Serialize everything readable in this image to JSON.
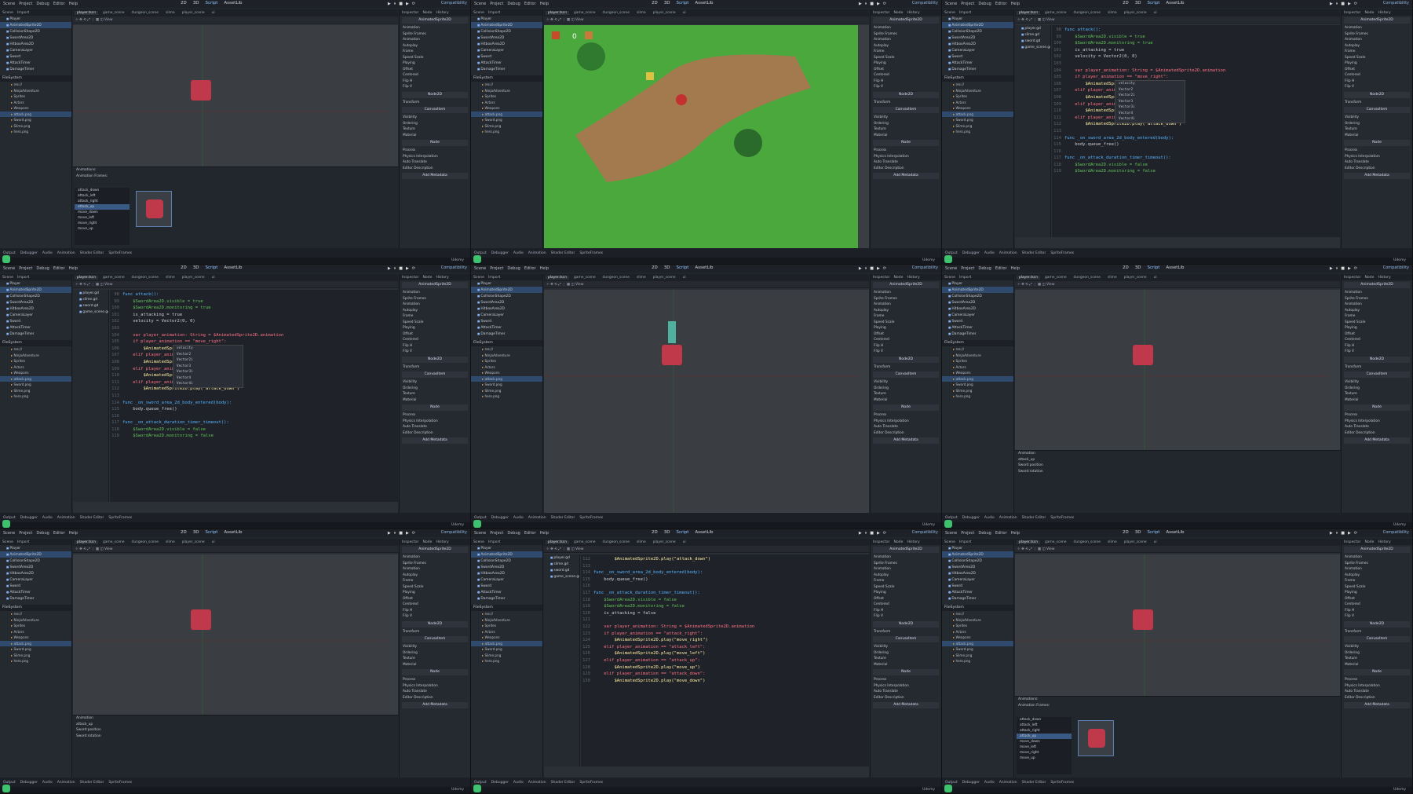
{
  "menu": [
    "Scene",
    "Project",
    "Debug",
    "Editor",
    "Help"
  ],
  "modes": [
    "2D",
    "3D",
    "Script",
    "AssetLib"
  ],
  "renderer": "Compatibility",
  "statusbar_text": "Udemy",
  "version": "4.3.stable",
  "scene_tabs": [
    "player.tscn",
    "game_scene",
    "dungeon_scene",
    "slime",
    "player_scene",
    "ui"
  ],
  "scene_tree": [
    "Player",
    "AnimatedSprite2D",
    "CollisionShape2D",
    "SwordArea2D",
    "HitboxArea2D",
    "CameraLayer",
    "Sword",
    "AttackTimer",
    "DamageTimer"
  ],
  "filesystem_title": "FileSystem",
  "filesystem": [
    "res://",
    "NinjaAdventure",
    "Sprites",
    "Actors",
    "Weapons",
    "attack.png",
    "Sword.png",
    "Slime.png",
    "hero.png"
  ],
  "bottom_tabs": [
    "Output",
    "Debugger",
    "Audio",
    "Animation",
    "Shader Editor",
    "SpriteFrames"
  ],
  "inspector": {
    "node": "AnimatedSprite2D",
    "rows": [
      "Animation",
      "Sprite Frames",
      "Animation",
      "Autoplay",
      "Frame",
      "Speed Scale",
      "Playing",
      "Offset",
      "Centered",
      "Flip H",
      "Flip V"
    ],
    "sections": [
      "Node2D",
      "CanvasItem",
      "Node"
    ],
    "subrows": [
      "Transform",
      "Visibility",
      "Ordering",
      "Texture",
      "Material",
      "Process",
      "Physics Interpolation",
      "Auto Translate",
      "Editor Description"
    ],
    "add_button": "Add Metadata"
  },
  "animations": [
    "attack_down",
    "attack_left",
    "attack_right",
    "attack_up",
    "move_down",
    "move_left",
    "move_right",
    "move_up"
  ],
  "anim_header": "Animations:",
  "frames_header": "Animation Frames:",
  "game_score": "0",
  "code_a": [
    {
      "n": "98",
      "t": "func attack():",
      "c": "fn"
    },
    {
      "n": "99",
      "t": "    $SwordArea2D.visible = true",
      "c": "node"
    },
    {
      "n": "100",
      "t": "    $SwordArea2D.monitoring = true",
      "c": "node"
    },
    {
      "n": "101",
      "t": "    is_attacking = true",
      "c": "var"
    },
    {
      "n": "102",
      "t": "    velocity = Vector2(0, 0)",
      "c": "var"
    },
    {
      "n": "103",
      "t": "",
      "c": "var"
    },
    {
      "n": "104",
      "t": "    var player_animation: String = $AnimatedSprite2D.animation",
      "c": "kw"
    },
    {
      "n": "105",
      "t": "    if player_animation == \"move_right\":",
      "c": "kw"
    },
    {
      "n": "106",
      "t": "        $AnimatedSprite2D.play(\"attack_right\")",
      "c": "str"
    },
    {
      "n": "107",
      "t": "    elif player_animation == \"move_left\":",
      "c": "kw"
    },
    {
      "n": "108",
      "t": "        $AnimatedSprite2D.play(\"attack_left\")",
      "c": "str"
    },
    {
      "n": "109",
      "t": "    elif player_animation == \"move_up\":",
      "c": "kw"
    },
    {
      "n": "110",
      "t": "        $AnimatedSprite2D.play(\"attack_up\")",
      "c": "str"
    },
    {
      "n": "111",
      "t": "    elif player_animation == \"move_down\":",
      "c": "kw"
    },
    {
      "n": "112",
      "t": "        $AnimatedSprite2D.play(\"attack_down\")",
      "c": "str"
    },
    {
      "n": "113",
      "t": "",
      "c": "var"
    },
    {
      "n": "114",
      "t": "func _on_sword_area_2d_body_entered(body):",
      "c": "fn"
    },
    {
      "n": "115",
      "t": "    body.queue_free()",
      "c": "var"
    },
    {
      "n": "116",
      "t": "",
      "c": "var"
    },
    {
      "n": "117",
      "t": "func _on_attack_duration_timer_timeout():",
      "c": "fn"
    },
    {
      "n": "118",
      "t": "    $SwordArea2D.visible = false",
      "c": "node"
    },
    {
      "n": "119",
      "t": "    $SwordArea2D.monitoring = false",
      "c": "node"
    }
  ],
  "code_b": [
    {
      "n": "112",
      "t": "        $AnimatedSprite2D.play(\"attack_down\")",
      "c": "str"
    },
    {
      "n": "113",
      "t": "",
      "c": "var"
    },
    {
      "n": "114",
      "t": "func _on_sword_area_2d_body_entered(body):",
      "c": "fn"
    },
    {
      "n": "115",
      "t": "    body.queue_free()",
      "c": "var"
    },
    {
      "n": "116",
      "t": "",
      "c": "var"
    },
    {
      "n": "117",
      "t": "func _on_attack_duration_timer_timeout():",
      "c": "fn"
    },
    {
      "n": "118",
      "t": "    $SwordArea2D.visible = false",
      "c": "node"
    },
    {
      "n": "119",
      "t": "    $SwordArea2D.monitoring = false",
      "c": "node"
    },
    {
      "n": "120",
      "t": "    is_attacking = false",
      "c": "var"
    },
    {
      "n": "121",
      "t": "",
      "c": "var"
    },
    {
      "n": "122",
      "t": "    var player_animation: String = $AnimatedSprite2D.animation",
      "c": "kw"
    },
    {
      "n": "123",
      "t": "    if player_animation == \"attack_right\":",
      "c": "kw"
    },
    {
      "n": "124",
      "t": "        $AnimatedSprite2D.play(\"move_right\")",
      "c": "str"
    },
    {
      "n": "125",
      "t": "    elif player_animation == \"attack_left\":",
      "c": "kw"
    },
    {
      "n": "126",
      "t": "        $AnimatedSprite2D.play(\"move_left\")",
      "c": "str"
    },
    {
      "n": "127",
      "t": "    elif player_animation == \"attack_up\":",
      "c": "kw"
    },
    {
      "n": "128",
      "t": "        $AnimatedSprite2D.play(\"move_up\")",
      "c": "str"
    },
    {
      "n": "129",
      "t": "    elif player_animation == \"attack_down\":",
      "c": "kw"
    },
    {
      "n": "130",
      "t": "        $AnimatedSprite2D.play(\"move_down\")",
      "c": "str"
    }
  ],
  "autocomplete": [
    "velocity",
    "Vector2",
    "Vector2i",
    "Vector3",
    "Vector3i",
    "Vector4",
    "Vector4i"
  ],
  "script_files": [
    "player.gd",
    "slime.gd",
    "sword.gd",
    "game_scene.gd"
  ],
  "timeline_label": "Animation",
  "timeline_anim": "attack_up",
  "timeline_tracks": [
    "Sword:position",
    "Sword:rotation"
  ]
}
